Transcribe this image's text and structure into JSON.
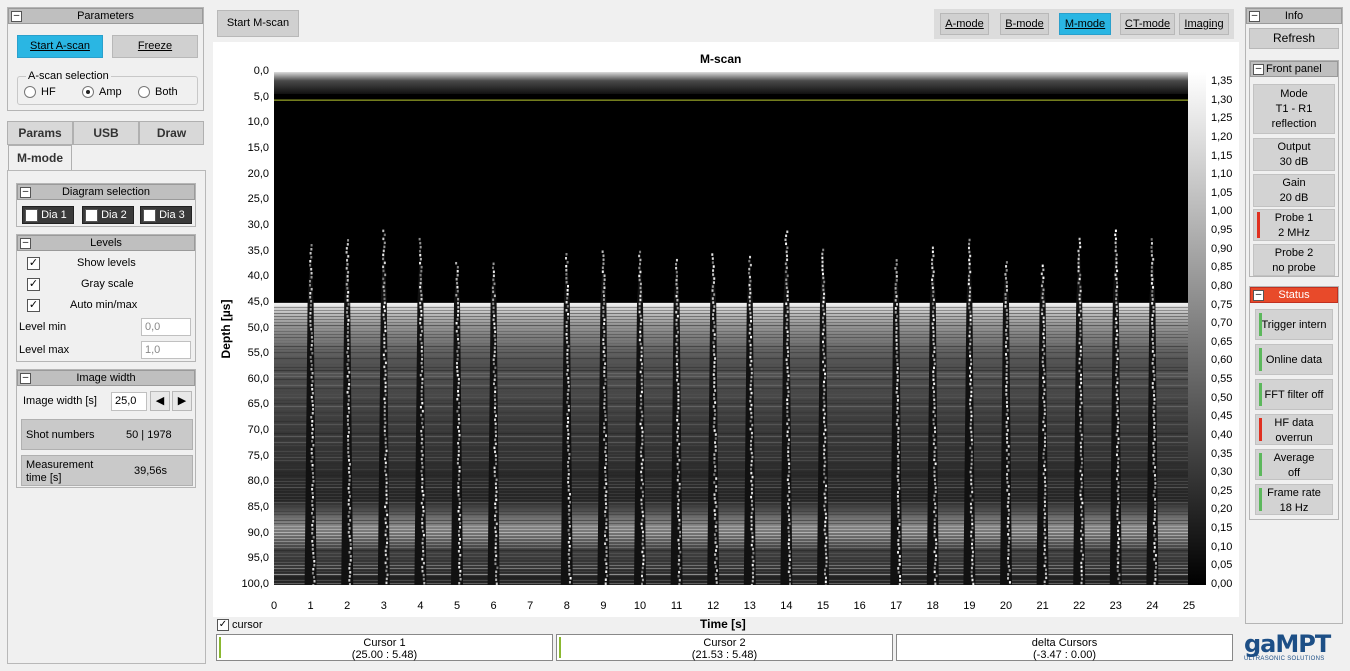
{
  "parameters": {
    "title": "Parameters",
    "start_ascan": "Start A-scan",
    "freeze": "Freeze",
    "ascan_selection": "A-scan selection",
    "options": [
      "HF",
      "Amp",
      "Both"
    ],
    "selected": "Amp"
  },
  "tabs": [
    "Params",
    "USB",
    "Draw",
    "M-mode"
  ],
  "diagram_selection": {
    "title": "Diagram selection",
    "items": [
      {
        "label": "Dia 1",
        "checked": true
      },
      {
        "label": "Dia 2",
        "checked": false
      },
      {
        "label": "Dia 3",
        "checked": false
      }
    ]
  },
  "levels": {
    "title": "Levels",
    "show_levels": "Show levels",
    "gray_scale": "Gray scale",
    "auto_minmax": "Auto min/max",
    "level_min_label": "Level min",
    "level_min_value": "0,0",
    "level_max_label": "Level max",
    "level_max_value": "1,0"
  },
  "image_width": {
    "title": "Image width",
    "label": "Image width [s]",
    "value": "25,0",
    "shot_numbers_label": "Shot numbers",
    "shot_numbers_value": "50 | 1978",
    "measurement_label_1": "Measurement",
    "measurement_label_2": "time [s]",
    "measurement_value": "39,56s"
  },
  "toolbar": {
    "start_mscan": "Start M-scan",
    "modes": [
      {
        "label": "A-mode",
        "active": false
      },
      {
        "label": "B-mode",
        "active": false
      },
      {
        "label": "M-mode",
        "active": true
      },
      {
        "label": "CT-mode",
        "active": false
      },
      {
        "label": "Imaging",
        "active": false
      }
    ]
  },
  "chart_data": {
    "type": "heatmap",
    "title": "M-scan",
    "xlabel": "Time [s]",
    "ylabel": "Depth [µs]",
    "xlim": [
      0,
      25
    ],
    "ylim": [
      0,
      100
    ],
    "x_ticks": [
      "0",
      "1",
      "2",
      "3",
      "4",
      "5",
      "6",
      "7",
      "8",
      "9",
      "10",
      "11",
      "12",
      "13",
      "14",
      "15",
      "16",
      "17",
      "18",
      "19",
      "20",
      "21",
      "22",
      "23",
      "24",
      "25"
    ],
    "y_ticks": [
      "0,0",
      "5,0",
      "10,0",
      "15,0",
      "20,0",
      "25,0",
      "30,0",
      "35,0",
      "40,0",
      "45,0",
      "50,0",
      "55,0",
      "60,0",
      "65,0",
      "70,0",
      "75,0",
      "80,0",
      "85,0",
      "90,0",
      "95,0",
      "100,0"
    ],
    "colorbar_ticks": [
      "1,35",
      "1,30",
      "1,25",
      "1,20",
      "1,15",
      "1,10",
      "1,05",
      "1,00",
      "0,95",
      "0,90",
      "0,85",
      "0,80",
      "0,75",
      "0,70",
      "0,65",
      "0,60",
      "0,55",
      "0,50",
      "0,45",
      "0,40",
      "0,35",
      "0,30",
      "0,25",
      "0,20",
      "0,15",
      "0,10",
      "0,05",
      "0,00"
    ],
    "colorbar_range": [
      0,
      1.35
    ],
    "bright_band_depth": [
      45,
      100
    ],
    "echo_times": [
      1,
      2,
      3,
      4,
      5,
      6,
      8,
      9,
      10,
      11,
      12,
      13,
      14,
      15,
      17,
      18,
      19,
      20,
      21,
      22,
      23,
      24
    ],
    "cursor_line_depth": 5.48
  },
  "cursor": {
    "label": "cursor",
    "checked": true,
    "boxes": [
      {
        "title": "Cursor 1",
        "value": "(25.00 : 5.48)"
      },
      {
        "title": "Cursor 2",
        "value": "(21.53 : 5.48)"
      },
      {
        "title": "delta Cursors",
        "value": "(-3.47 : 0.00)"
      }
    ]
  },
  "info": {
    "title": "Info",
    "refresh": "Refresh",
    "front_panel": "Front panel",
    "mode_lines": [
      "Mode",
      "T1 - R1",
      "reflection"
    ],
    "output_lines": [
      "Output",
      "30 dB"
    ],
    "gain_lines": [
      "Gain",
      "20 dB"
    ],
    "probe1_lines": [
      "Probe 1",
      "2 MHz"
    ],
    "probe2_lines": [
      "Probe 2",
      "no probe"
    ],
    "status_title": "Status",
    "status_items": [
      {
        "lines": [
          "Trigger intern"
        ],
        "color": "#5cb85c"
      },
      {
        "lines": [
          "Online data"
        ],
        "color": "#5cb85c"
      },
      {
        "lines": [
          "FFT filter off"
        ],
        "color": "#5cb85c"
      },
      {
        "lines": [
          "HF data",
          "overrun"
        ],
        "color": "#e03020"
      },
      {
        "lines": [
          "Average",
          "off"
        ],
        "color": "#5cb85c"
      },
      {
        "lines": [
          "Frame rate",
          "18 Hz"
        ],
        "color": "#5cb85c"
      }
    ]
  },
  "logo": {
    "name": "gaMPT",
    "tagline": "ULTRASONIC SOLUTIONS"
  }
}
